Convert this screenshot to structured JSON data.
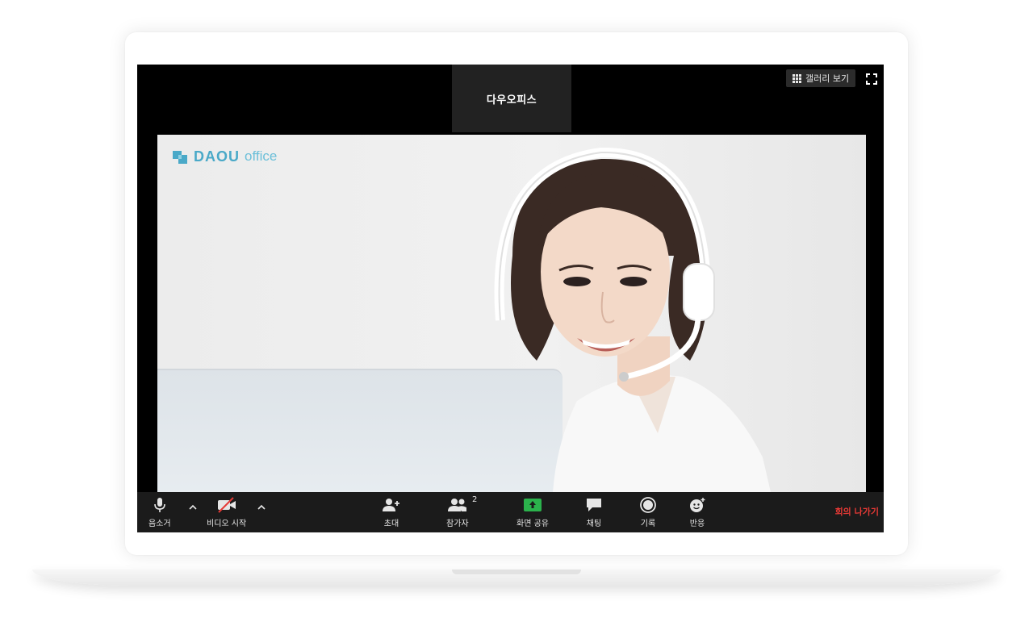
{
  "meeting": {
    "speaker_name": "다우오피스",
    "gallery_view_label": "갤러리 보기"
  },
  "video": {
    "logo_brand": "DAOU",
    "logo_sub": "office"
  },
  "toolbar": {
    "mute_label": "음소거",
    "video_label": "비디오 시작",
    "invite_label": "초대",
    "participants_label": "참가자",
    "participants_count": "2",
    "share_label": "화면 공유",
    "chat_label": "채팅",
    "record_label": "기록",
    "reactions_label": "반응",
    "leave_label": "회의 나가기"
  },
  "colors": {
    "share_green": "#2bb24c",
    "leave_red": "#e53935",
    "logo_blue": "#4aa9c8"
  },
  "icons": [
    "microphone-icon",
    "video-off-icon",
    "invite-icon",
    "participants-icon",
    "share-screen-icon",
    "chat-icon",
    "record-icon",
    "reactions-icon",
    "grid-icon",
    "fullscreen-icon"
  ]
}
